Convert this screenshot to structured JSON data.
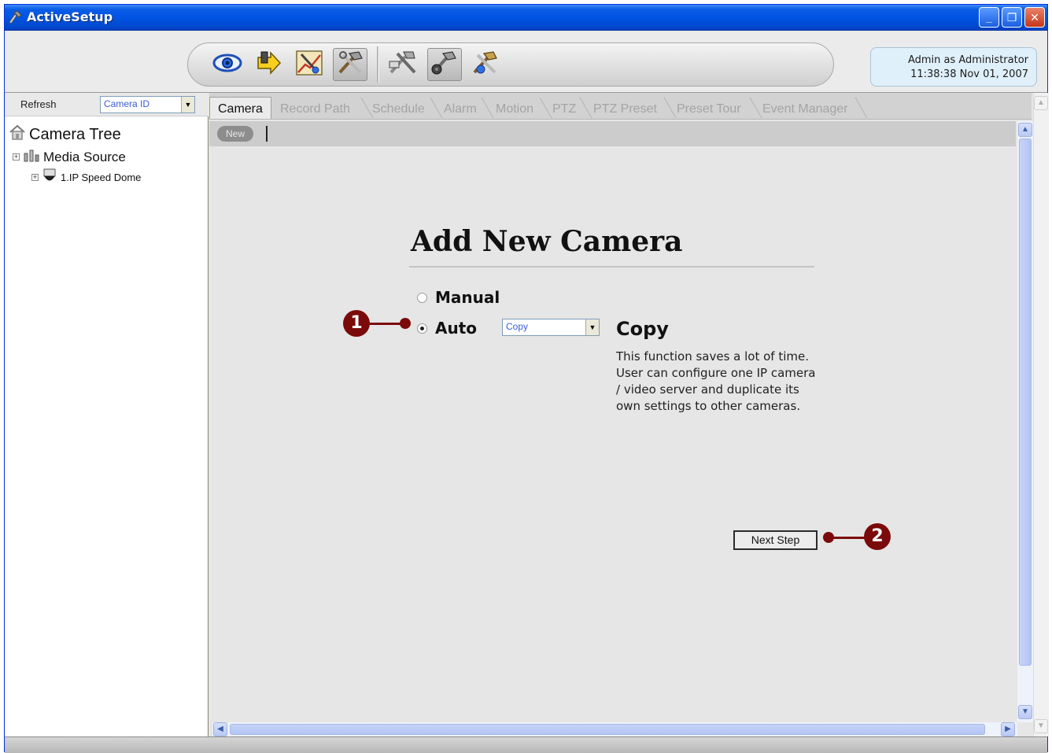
{
  "window": {
    "title": "ActiveSetup",
    "minimize_label": "_",
    "restore_label": "❐",
    "close_label": "✕"
  },
  "toolbar": {
    "buttons": [
      {
        "icon": "eye-icon"
      },
      {
        "icon": "export-arrow-icon"
      },
      {
        "icon": "tools-chart-icon"
      },
      {
        "icon": "hammer-wrench-icon",
        "active": true
      },
      {
        "icon": "multi-tools-icon"
      },
      {
        "icon": "camera-tools-icon",
        "active": true
      },
      {
        "icon": "settings-tools-icon"
      }
    ]
  },
  "status": {
    "user": "Admin as Administrator",
    "datetime": "11:38:38 Nov 01, 2007"
  },
  "left_panel": {
    "refresh_label": "Refresh",
    "sort_select": "Camera ID",
    "tree_root": "Camera Tree",
    "tree_items": [
      {
        "label": "Media Source",
        "level": 1
      },
      {
        "label": "1.IP Speed Dome",
        "level": 2
      }
    ]
  },
  "tabs": [
    {
      "label": "Camera",
      "active": true
    },
    {
      "label": "Record Path"
    },
    {
      "label": "Schedule"
    },
    {
      "label": "Alarm"
    },
    {
      "label": "Motion"
    },
    {
      "label": "PTZ"
    },
    {
      "label": "PTZ Preset"
    },
    {
      "label": "Preset Tour"
    },
    {
      "label": "Event Manager"
    }
  ],
  "subbar": {
    "new_label": "New"
  },
  "form": {
    "title": "Add New Camera",
    "option_manual": "Manual",
    "option_auto": "Auto",
    "selected": "Auto",
    "auto_select_value": "Copy",
    "copy_heading": "Copy",
    "copy_description": "This function saves a lot of time. User can configure one IP camera / video server and duplicate its own settings to other cameras.",
    "next_button": "Next Step"
  },
  "callouts": [
    "1",
    "2"
  ],
  "colors": {
    "title_bar": "#0054e3",
    "callout": "#7b0a0a",
    "status_bg": "#dff0fb",
    "link_blue": "#3a5bd9"
  }
}
